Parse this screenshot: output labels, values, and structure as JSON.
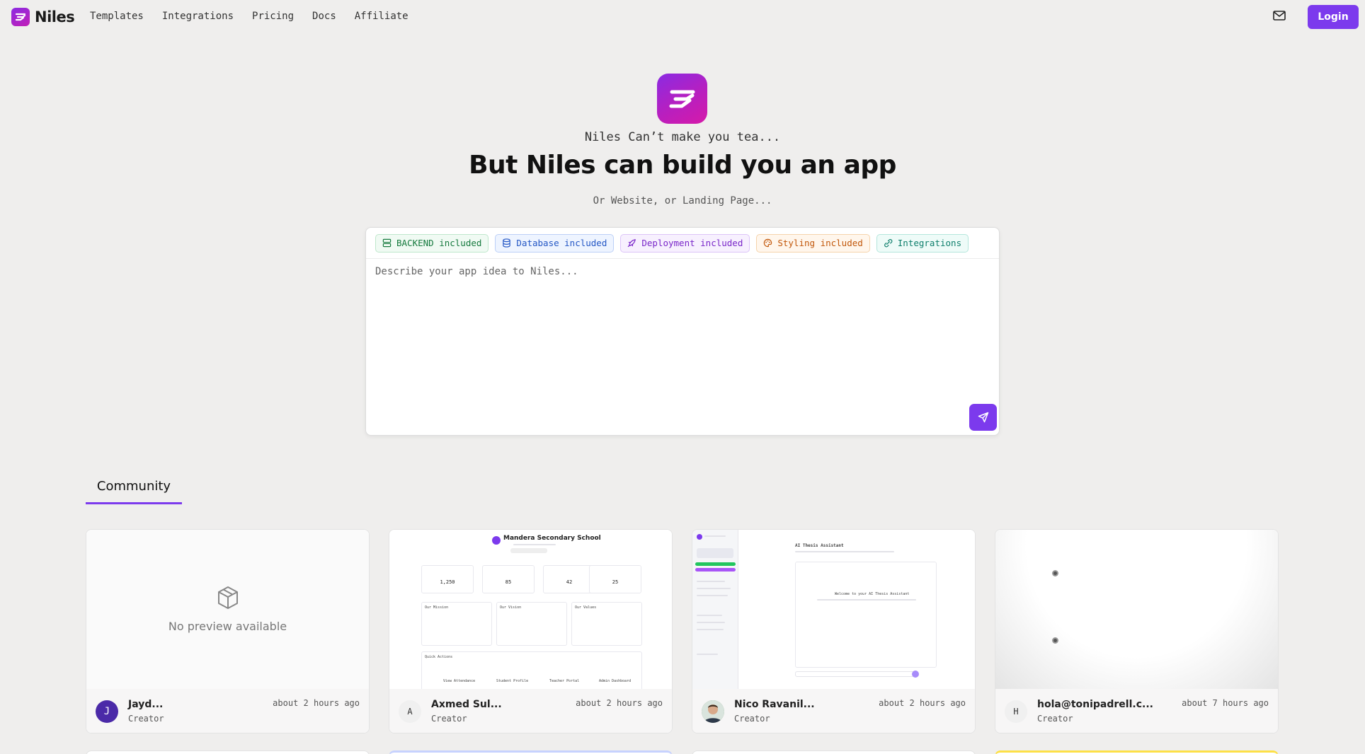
{
  "nav": {
    "brand": "Niles",
    "links": [
      "Templates",
      "Integrations",
      "Pricing",
      "Docs",
      "Affiliate"
    ],
    "mail_icon": "mail-icon",
    "login_label": "Login"
  },
  "hero": {
    "kicker": "Niles Can’t make you tea...",
    "title": "But Niles can build you an app",
    "subtitle": "Or Website, or Landing Page..."
  },
  "prompt": {
    "tags": [
      {
        "label": "BACKEND included",
        "icon": "server-icon"
      },
      {
        "label": "Database included",
        "icon": "database-icon"
      },
      {
        "label": "Deployment included",
        "icon": "rocket-icon"
      },
      {
        "label": "Styling included",
        "icon": "palette-icon"
      },
      {
        "label": "Integrations",
        "icon": "plug-icon"
      }
    ],
    "placeholder": "Describe your app idea to Niles...",
    "send_icon": "send-icon"
  },
  "community": {
    "tab_label": "Community",
    "cards": [
      {
        "preview": {
          "no_preview_text": "No preview available"
        },
        "creator_initial": "J",
        "creator_name": "Jayd...",
        "creator_role": "Creator",
        "time": "about 2 hours ago"
      },
      {
        "preview": {
          "title": "Mandera Secondary School",
          "stats": [
            "1,250",
            "85",
            "42",
            "25"
          ],
          "sections": [
            "Our Mission",
            "Our Vision",
            "Our Values"
          ],
          "quick_actions": "Quick Actions",
          "actions": [
            "View Attendance",
            "Student Profile",
            "Teacher Portal",
            "Admin Dashboard"
          ]
        },
        "creator_initial": "A",
        "creator_name": "Axmed Sul...",
        "creator_role": "Creator",
        "time": "about 2 hours ago"
      },
      {
        "preview": {
          "heading": "AI Thesis Assistant",
          "welcome": "Welcome to your AI Thesis Assistant"
        },
        "creator_initial": "",
        "creator_name": "Nico Ravanil...",
        "creator_role": "Creator",
        "time": "about 2 hours ago"
      },
      {
        "preview": {},
        "creator_initial": "H",
        "creator_name": "hola@tonipadrell.c...",
        "creator_role": "Creator",
        "time": "about 7 hours ago"
      }
    ]
  },
  "colors": {
    "accent": "#7c3aed",
    "background": "#efeeed"
  }
}
